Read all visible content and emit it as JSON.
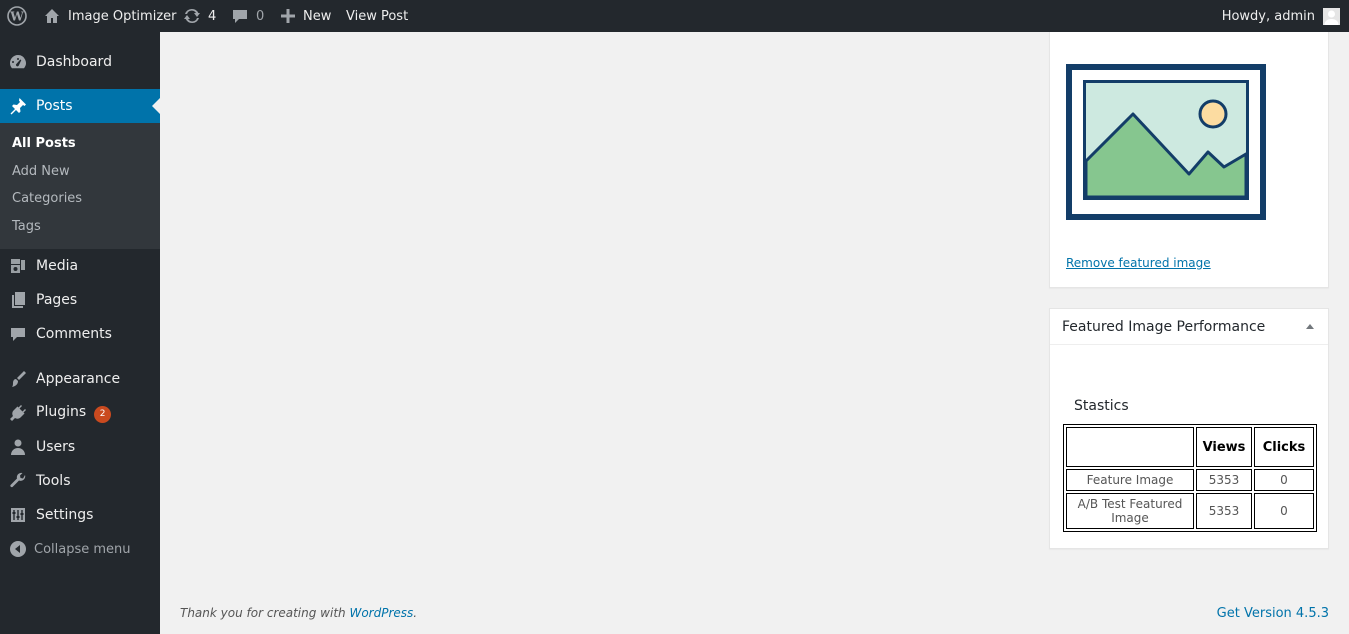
{
  "adminbar": {
    "site_name": "Image Optimizer",
    "updates_count": "4",
    "comments_count": "0",
    "new_label": "New",
    "view_post_label": "View Post",
    "howdy": "Howdy, admin"
  },
  "sidebar": {
    "items": {
      "dashboard": "Dashboard",
      "posts": "Posts",
      "media": "Media",
      "pages": "Pages",
      "comments": "Comments",
      "appearance": "Appearance",
      "plugins": "Plugins",
      "users": "Users",
      "tools": "Tools",
      "settings": "Settings",
      "collapse": "Collapse menu"
    },
    "plugins_badge": "2",
    "submenu": {
      "all_posts": "All Posts",
      "add_new": "Add New",
      "categories": "Categories",
      "tags": "Tags"
    }
  },
  "featured": {
    "remove_label": "Remove featured image"
  },
  "performance": {
    "title": "Featured Image Performance",
    "stats_heading": "Stastics",
    "columns": [
      "",
      "Views",
      "Clicks"
    ],
    "rows": [
      {
        "label": "Feature Image",
        "views": "5353",
        "clicks": "0"
      },
      {
        "label": "A/B Test Featured Image",
        "views": "5353",
        "clicks": "0"
      }
    ]
  },
  "footer": {
    "thanks_prefix": "Thank you for creating with ",
    "wordpress_link": "WordPress",
    "thanks_suffix": ".",
    "version": "Get Version 4.5.3"
  },
  "colors": {
    "accent": "#0073aa",
    "sidebar_bg": "#23282d",
    "badge": "#ca4a1f"
  }
}
